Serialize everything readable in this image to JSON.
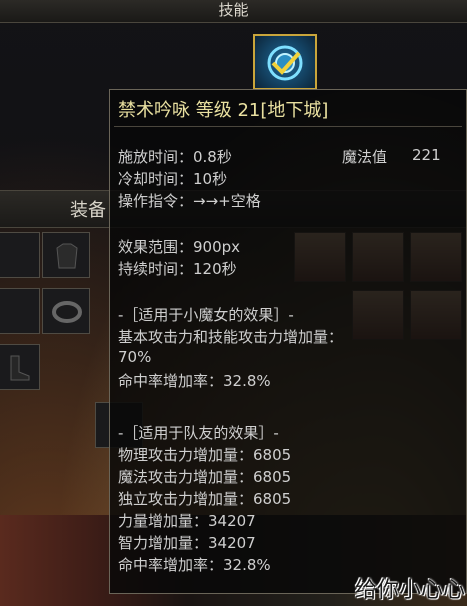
{
  "header": {
    "title": "技能"
  },
  "equipment": {
    "label": "装备"
  },
  "tooltip": {
    "title": "禁术吟咏 等级 21[地下城]",
    "cast_time": "施放时间：0.8秒",
    "mp_label": "魔法值",
    "mp_value": "221",
    "cooldown": "冷却时间：10秒",
    "command": "操作指令：→→+空格",
    "effect_range": "效果范围：900px",
    "duration": "持续时间：120秒",
    "self_section": "-［适用于小魔女的效果］-",
    "self_atk_line1": "基本攻击力和技能攻击力增加量：",
    "self_atk_line2": "70%",
    "self_hit": "命中率增加率：32.8%",
    "party_section": "-［适用于队友的效果］-",
    "party_phys": "物理攻击力增加量：6805",
    "party_mag": "魔法攻击力增加量：6805",
    "party_indep": "独立攻击力增加量：6805",
    "party_str": "力量增加量：34207",
    "party_int": "智力增加量：34207",
    "party_hit": "命中率增加率：32.8%"
  },
  "watermark": "给你小心心"
}
